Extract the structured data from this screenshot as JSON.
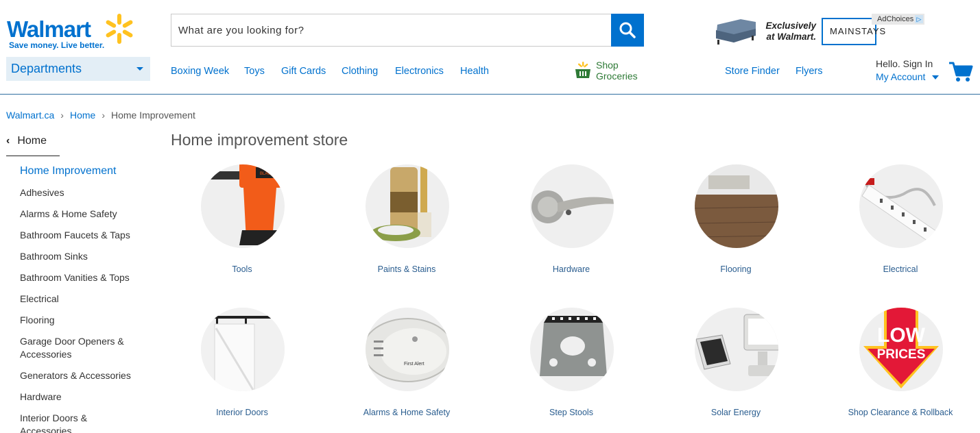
{
  "brand": {
    "name": "Walmart",
    "tagline": "Save money. Live better.",
    "color": "#0071ce",
    "spark_color": "#ffc220"
  },
  "search": {
    "placeholder": "What are you looking for?",
    "icon": "search-icon"
  },
  "ad": {
    "headline_line1": "Exclusively",
    "headline_line2": "at Walmart.",
    "brand": "MAINSTAYS",
    "adchoices": "AdChoices"
  },
  "departments_label": "Departments",
  "nav": {
    "links": [
      "Boxing Week",
      "Toys",
      "Gift Cards",
      "Clothing",
      "Electronics",
      "Health"
    ],
    "shop_groceries_line1": "Shop",
    "shop_groceries_line2": "Groceries",
    "store_finder": "Store Finder",
    "flyers": "Flyers"
  },
  "account": {
    "greeting": "Hello. Sign In",
    "label": "My Account"
  },
  "breadcrumb": [
    "Walmart.ca",
    "Home",
    "Home Improvement"
  ],
  "sidebar": {
    "back_label": "Home",
    "current": "Home Improvement",
    "items": [
      "Adhesives",
      "Alarms & Home Safety",
      "Bathroom Faucets & Taps",
      "Bathroom Sinks",
      "Bathroom Vanities & Tops",
      "Electrical",
      "Flooring",
      "Garage Door Openers & Accessories",
      "Generators & Accessories",
      "Hardware",
      "Interior Doors & Accessories"
    ]
  },
  "main": {
    "title": "Home improvement store",
    "categories": [
      "Tools",
      "Paints & Stains",
      "Hardware",
      "Flooring",
      "Electrical",
      "Interior Doors",
      "Alarms & Home Safety",
      "Step Stools",
      "Solar Energy",
      "Shop Clearance & Rollback"
    ],
    "promo_text_line1": "LOW",
    "promo_text_line2": "PRICES"
  }
}
